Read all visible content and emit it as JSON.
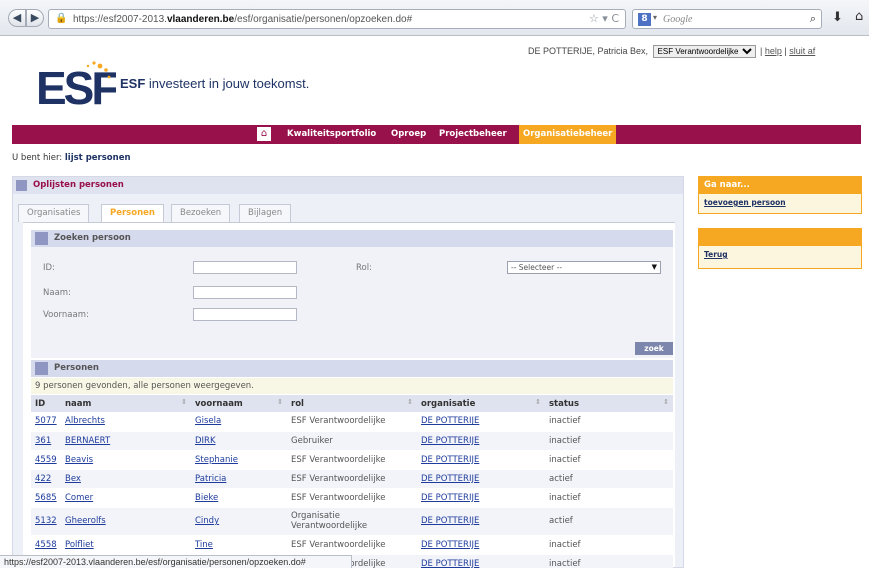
{
  "browser": {
    "url_prefix": "https://esf2007-2013.",
    "url_domain": "vlaanderen.be",
    "url_path": "/esf/organisatie/personen/opzoeken.do#",
    "search_placeholder": "Google",
    "status_url": "https://esf2007-2013.vlaanderen.be/esf/organisatie/personen/opzoeken.do#"
  },
  "user": {
    "name": "DE POTTERIJE,  Patricia Bex,",
    "role": "ESF Verantwoordelijke",
    "help": "help",
    "logout": "sluit af"
  },
  "brand": {
    "tagline_bold": "ESF",
    "tagline_rest": "investeert in jouw toekomst.",
    "colors": {
      "primary": "#98114b",
      "accent": "#f7a823",
      "navy": "#1e3264"
    }
  },
  "nav": {
    "items": [
      "Kwaliteitsportfolio",
      "Oproep",
      "Projectbeheer",
      "Organisatiebeheer"
    ],
    "active": "Organisatiebeheer"
  },
  "breadcrumb": {
    "prefix": "U bent hier:",
    "current": "lijst personen"
  },
  "panel": {
    "title": "Oplijsten personen"
  },
  "tabs": [
    "Organisaties",
    "Personen",
    "Bezoeken",
    "Bijlagen"
  ],
  "active_tab": "Personen",
  "search": {
    "title": "Zoeken persoon",
    "id_label": "ID:",
    "naam_label": "Naam:",
    "voornaam_label": "Voornaam:",
    "rol_label": "Rol:",
    "rol_value": "-- Selecteer --",
    "button": "zoek"
  },
  "results": {
    "title": "Personen",
    "count_text": "9 personen gevonden, alle personen weergegeven.",
    "headers": [
      "ID",
      "naam",
      "voornaam",
      "rol",
      "organisatie",
      "status"
    ],
    "rows": [
      [
        "5077",
        "Albrechts",
        "Gisela",
        "ESF Verantwoordelijke",
        "DE POTTERIJE",
        "inactief"
      ],
      [
        "361",
        "BERNAERT",
        "DIRK",
        "Gebruiker",
        "DE POTTERIJE",
        "inactief"
      ],
      [
        "4559",
        "Beavis",
        "Stephanie",
        "ESF Verantwoordelijke",
        "DE POTTERIJE",
        "inactief"
      ],
      [
        "422",
        "Bex",
        "Patricia",
        "ESF Verantwoordelijke",
        "DE POTTERIJE",
        "actief"
      ],
      [
        "5685",
        "Comer",
        "Bieke",
        "ESF Verantwoordelijke",
        "DE POTTERIJE",
        "inactief"
      ],
      [
        "5132",
        "Gheerolfs",
        "Cindy",
        "Organisatie Verantwoordelijke",
        "DE POTTERIJE",
        "actief"
      ],
      [
        "4558",
        "Polfliet",
        "Tine",
        "ESF Verantwoordelijke",
        "DE POTTERIJE",
        "inactief"
      ],
      [
        "",
        "",
        "",
        "ESF Verantwoordelijke",
        "DE POTTERIJE",
        "inactief"
      ]
    ]
  },
  "sidebar": {
    "goto_title": "Ga naar...",
    "goto_link": "toevoegen persoon",
    "back_link": "Terug"
  }
}
